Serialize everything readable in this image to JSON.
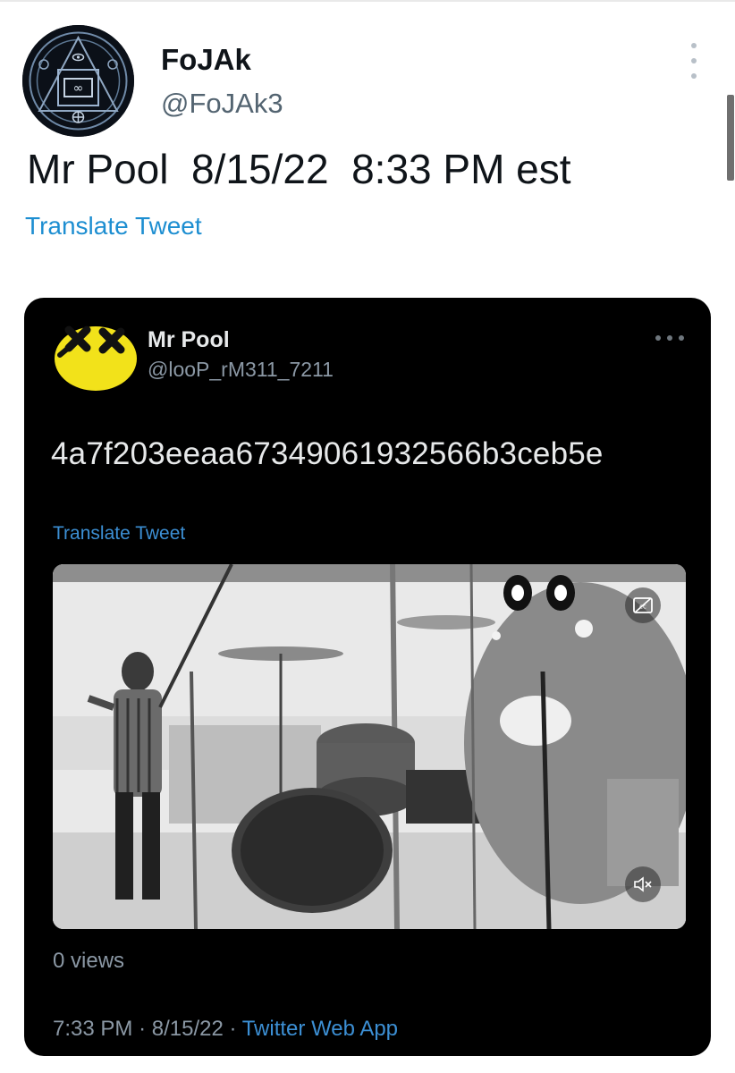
{
  "tweet": {
    "author": {
      "display_name": "FoJAk",
      "handle": "@FoJAk3",
      "avatar_icon": "occult-sigil-icon"
    },
    "text": "Mr Pool  8/15/22  8:33 PM est",
    "translate_label": "Translate Tweet",
    "menu_icon": "more-vertical-icon"
  },
  "embedded_tweet": {
    "author": {
      "display_name": "Mr Pool",
      "handle": "@looP_rM311_7211",
      "avatar_icon": "yellow-dead-smiley-icon"
    },
    "text": "4a7f203eeaa67349061932566b3ceb5e",
    "translate_label": "Translate Tweet",
    "menu_icon": "more-horizontal-icon",
    "video": {
      "description_icon": "video-thumbnail",
      "captions_icon": "captions-off-icon",
      "mute_icon": "muted-speaker-icon"
    },
    "views": "0 views",
    "time": "7:33 PM",
    "date": "8/15/22",
    "separator": "·",
    "source_app": "Twitter Web App"
  },
  "colors": {
    "link_blue": "#1d8ed1",
    "dark_card": "#000000",
    "muted_text": "#8b98a5"
  }
}
